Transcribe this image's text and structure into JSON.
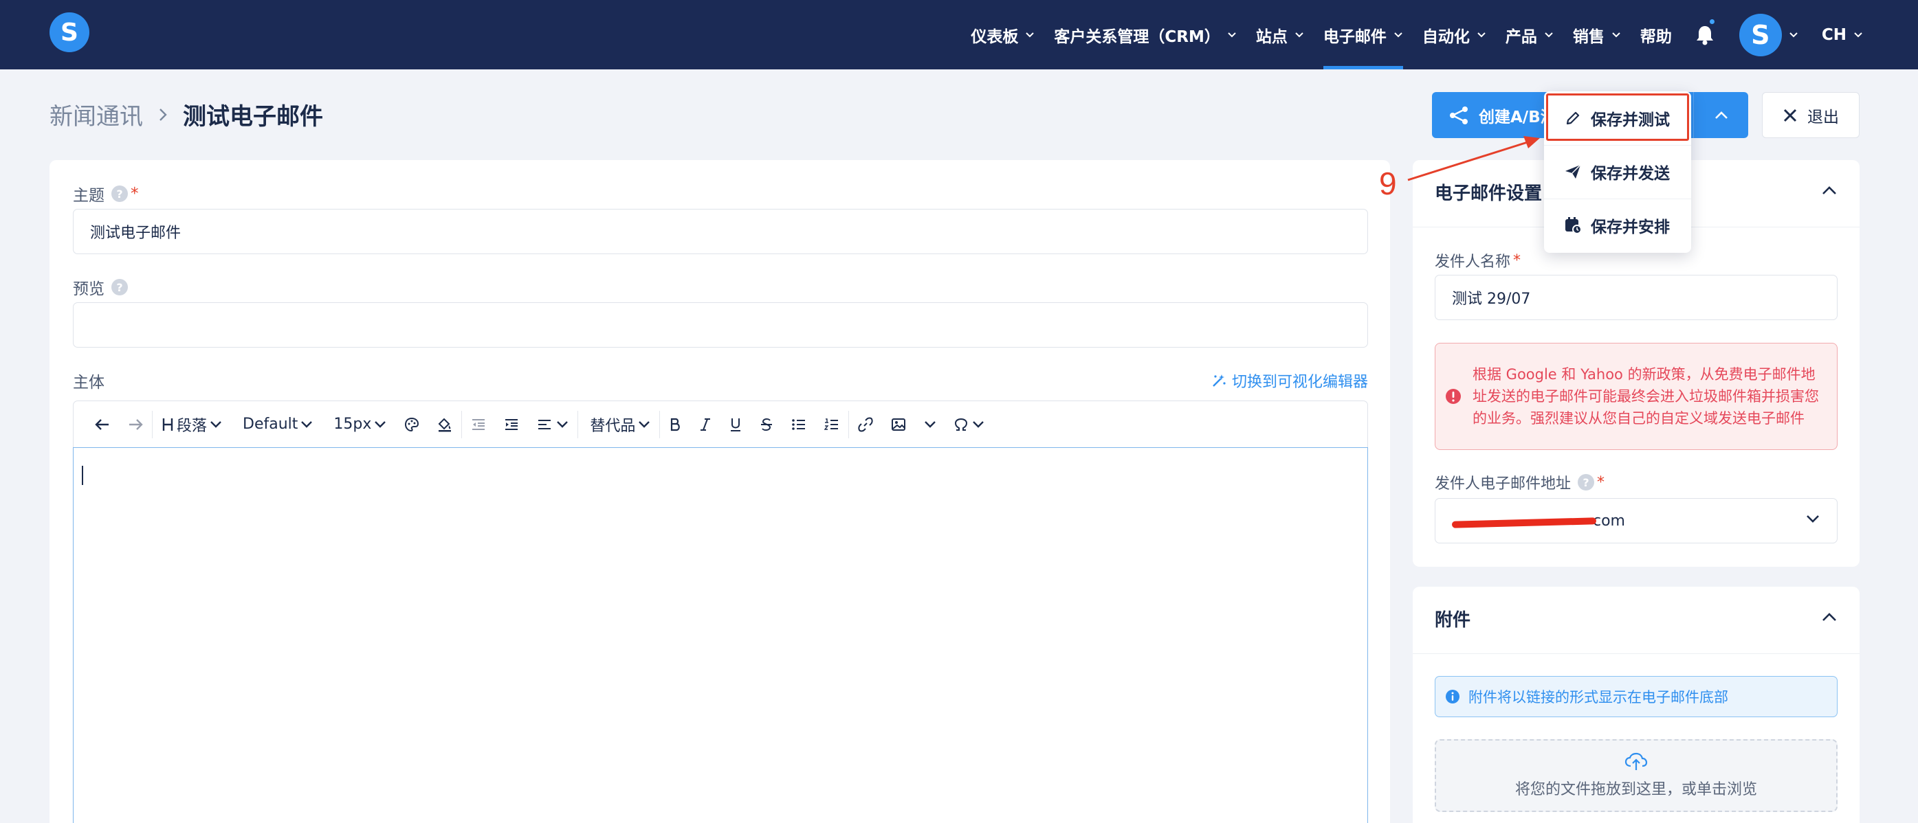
{
  "nav": {
    "items": [
      {
        "label": "仪表板"
      },
      {
        "label": "客户关系管理（CRM）"
      },
      {
        "label": "站点"
      },
      {
        "label": "电子邮件",
        "active": true
      },
      {
        "label": "自动化"
      },
      {
        "label": "产品"
      },
      {
        "label": "销售"
      },
      {
        "label": "帮助"
      }
    ],
    "logo_letter": "S",
    "avatar_letter": "S",
    "language": "CH"
  },
  "header": {
    "breadcrumb_parent": "新闻通讯",
    "breadcrumb_current": "测试电子邮件",
    "ab_button_label": "创建A/B测试",
    "exit_label": "退出"
  },
  "dropdown": {
    "items": [
      {
        "label": "保存并测试",
        "icon": "pencil-icon"
      },
      {
        "label": "保存并发送",
        "icon": "paper-plane-icon"
      },
      {
        "label": "保存并安排",
        "icon": "calendar-clock-icon"
      }
    ],
    "highlight_color": "#e5402a"
  },
  "annotation": {
    "number": "9"
  },
  "form": {
    "subject_label": "主题",
    "subject_value": "测试电子邮件",
    "preview_label": "预览",
    "preview_value": "",
    "body_label": "主体",
    "switch_editor_label": "切换到可视化编辑器"
  },
  "toolbar": {
    "paragraph_label": "段落",
    "font_label": "Default",
    "size_label": "15px",
    "replace_label": "替代品"
  },
  "settings": {
    "title": "电子邮件设置",
    "sender_name_label": "发件人名称",
    "sender_name_value": "测试 29/07",
    "warning_text": "根据 Google 和 Yahoo 的新政策，从免费电子邮件地址发送的电子邮件可能最终会进入垃圾邮件箱并损害您的业务。强烈建议从您自己的自定义域发送电子邮件",
    "sender_email_label": "发件人电子邮件地址",
    "sender_email_suffix": "com"
  },
  "attachments": {
    "title": "附件",
    "info_text": "附件将以链接的形式显示在电子邮件底部",
    "dropzone_text": "将您的文件拖放到这里，或单击浏览"
  },
  "colors": {
    "navbar": "#1b2a55",
    "accent": "#2f8fef",
    "annotation": "#e5402a"
  }
}
